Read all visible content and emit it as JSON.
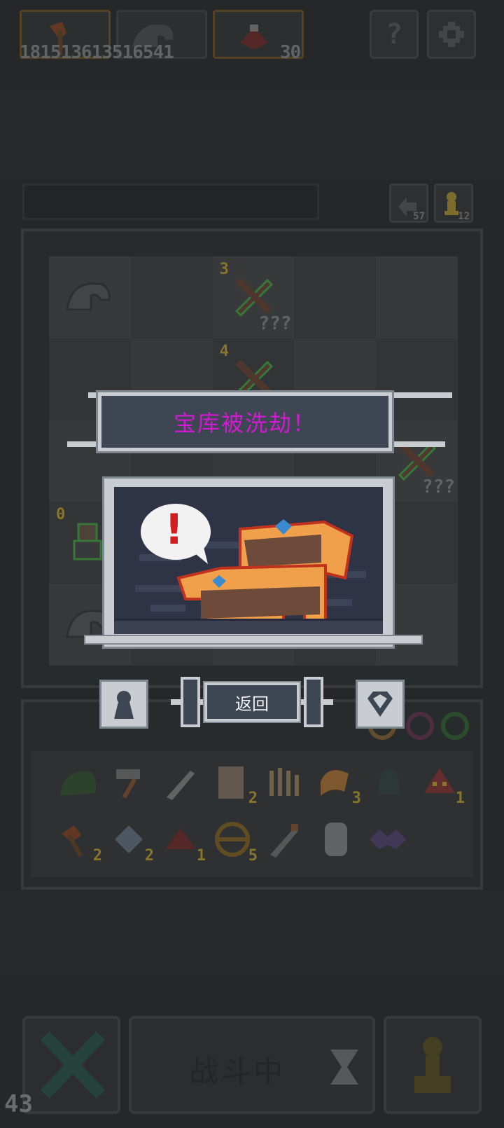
{
  "top_bar": {
    "stats_text": "181513613516541",
    "count": "30",
    "slots": [
      "axe-icon",
      "helmet-icon",
      "red-spider-icon"
    ],
    "help_label": "?",
    "settings_icon": "gear-icon"
  },
  "side_counters": {
    "undo_count": "57",
    "pawn_count": "12"
  },
  "board": {
    "cells": [
      {
        "level": "",
        "unknown": "",
        "icon": "helmet-icon"
      },
      {
        "level": "3",
        "unknown": "???",
        "icon": "sword-icon"
      },
      {
        "level": "4",
        "unknown": "",
        "icon": "sword-icon"
      },
      {
        "level": "",
        "unknown": "???",
        "icon": "sword-icon"
      },
      {
        "level": "0",
        "unknown": "",
        "icon": "warrior-icon"
      },
      {
        "level": "",
        "unknown": "",
        "icon": "helmet-icon"
      }
    ]
  },
  "modal": {
    "banner_text": "宝库被洗劫！",
    "return_label": "返回",
    "exclaim": "!"
  },
  "inventory": {
    "row1": [
      {
        "icon": "green-helmet-icon",
        "count": ""
      },
      {
        "icon": "hammer-icon",
        "count": ""
      },
      {
        "icon": "dagger-icon",
        "count": ""
      },
      {
        "icon": "scroll-icon",
        "count": "2"
      },
      {
        "icon": "claw-icon",
        "count": ""
      },
      {
        "icon": "horn-icon",
        "count": "3"
      },
      {
        "icon": "bell-icon",
        "count": ""
      },
      {
        "icon": "red-mask-icon",
        "count": "1"
      }
    ],
    "row2": [
      {
        "icon": "axe-icon",
        "count": "2"
      },
      {
        "icon": "battle-axe-icon",
        "count": "2"
      },
      {
        "icon": "red-spider-icon",
        "count": "1"
      },
      {
        "icon": "coin-icon",
        "count": "5"
      },
      {
        "icon": "sword-icon",
        "count": ""
      },
      {
        "icon": "mirror-icon",
        "count": ""
      },
      {
        "icon": "purple-bat-icon",
        "count": ""
      }
    ]
  },
  "bottom_bar": {
    "fight_label": "战斗中",
    "corner_number": "43"
  },
  "colors": {
    "banner_text": "#d21ad2",
    "level": "#c7a838",
    "chest": "#f0a04a"
  }
}
